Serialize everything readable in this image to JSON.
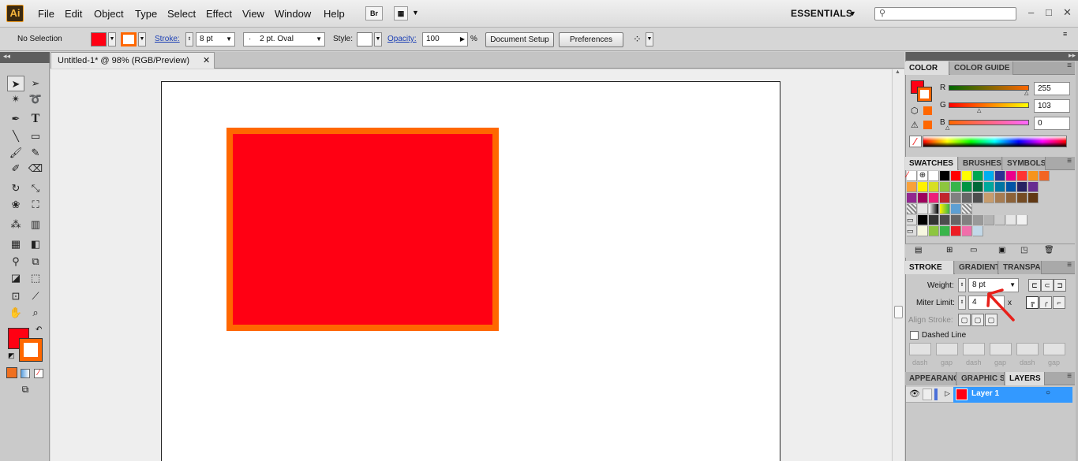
{
  "app": {
    "logo": "Ai",
    "workspace": "ESSENTIALS"
  },
  "menu": [
    "File",
    "Edit",
    "Object",
    "Type",
    "Select",
    "Effect",
    "View",
    "Window",
    "Help"
  ],
  "toolbar_icons": {
    "bridge": "Br"
  },
  "window_controls": {
    "minimize": "–",
    "restore": "□",
    "close": "✕"
  },
  "control": {
    "selection": "No Selection",
    "stroke_label": "Stroke:",
    "stroke_weight": "8 pt",
    "brush": "2 pt. Oval",
    "brush_dot": "·",
    "style_label": "Style:",
    "opacity_label": "Opacity:",
    "opacity_value": "100",
    "percent": "%",
    "doc_setup": "Document Setup",
    "preferences": "Preferences"
  },
  "doc_tab": {
    "title": "Untitled-1* @ 98% (RGB/Preview)",
    "close": "✕"
  },
  "colors": {
    "fill": "#ff0013",
    "stroke": "#ff6700",
    "artboard": "#ffffff"
  },
  "color_panel": {
    "tabs": [
      "COLOR",
      "COLOR GUIDE"
    ],
    "channels": [
      {
        "name": "R",
        "value": "255"
      },
      {
        "name": "G",
        "value": "103"
      },
      {
        "name": "B",
        "value": "0"
      }
    ]
  },
  "swatches_panel": {
    "tabs": [
      "SWATCHES",
      "BRUSHES",
      "SYMBOLS"
    ]
  },
  "stroke_panel": {
    "tabs": [
      "STROKE",
      "GRADIENT",
      "TRANSPAR"
    ],
    "weight_label": "Weight:",
    "weight_value": "8 pt",
    "miter_label": "Miter Limit:",
    "miter_value": "4",
    "miter_unit": "x",
    "align_label": "Align Stroke:",
    "dashed_label": "Dashed Line",
    "dash_labels": [
      "dash",
      "gap",
      "dash",
      "gap",
      "dash",
      "gap"
    ]
  },
  "layers_panel": {
    "tabs": [
      "APPEARANC",
      "GRAPHIC ST",
      "LAYERS"
    ],
    "layer_name": "Layer 1"
  },
  "icons": [
    "ai-logo",
    "bridge-icon",
    "arrange-documents-icon",
    "search-icon",
    "minimize-icon",
    "restore-icon",
    "close-icon",
    "selection-tool-icon",
    "direct-selection-tool-icon",
    "magic-wand-icon",
    "lasso-icon",
    "pen-tool-icon",
    "type-tool-icon",
    "line-tool-icon",
    "rectangle-tool-icon",
    "paintbrush-icon",
    "pencil-icon",
    "blob-brush-icon",
    "eraser-icon",
    "rotate-icon",
    "scale-icon",
    "warp-icon",
    "free-transform-icon",
    "symbol-sprayer-icon",
    "graph-icon",
    "mesh-icon",
    "gradient-icon",
    "eyedropper-icon",
    "blend-icon",
    "live-paint-icon",
    "live-paint-select-icon",
    "artboard-icon",
    "slice-icon",
    "hand-icon",
    "zoom-icon",
    "swap-icon",
    "default-colors-icon",
    "eye-icon",
    "annotation-arrow-icon"
  ]
}
